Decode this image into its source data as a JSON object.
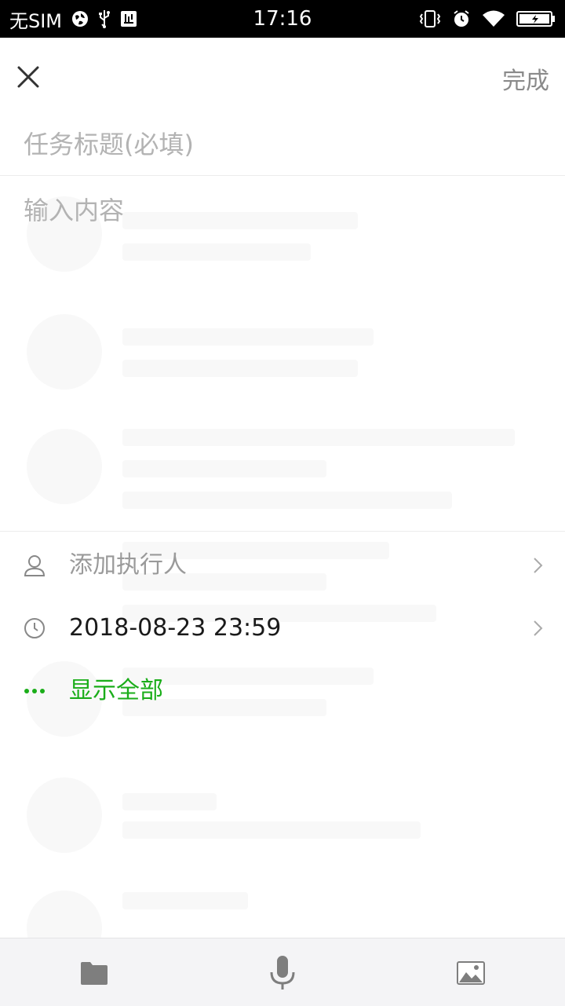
{
  "status_bar": {
    "carrier": "无SIM",
    "time": "17:16"
  },
  "header": {
    "done_label": "完成"
  },
  "form": {
    "title_placeholder": "任务标题(必填)",
    "content_placeholder": "输入内容"
  },
  "options": {
    "assignee_label": "添加执行人",
    "deadline_value": "2018-08-23 23:59",
    "show_all_label": "显示全部"
  },
  "colors": {
    "accent": "#1aad19",
    "placeholder": "#b3b3b3",
    "primary_text": "#1a1a1a",
    "icon_gray": "#888888",
    "toolbar_bg": "#f4f4f6"
  },
  "icons": {
    "close": "close-icon",
    "person": "person-icon",
    "clock": "clock-icon",
    "chevron": "chevron-right-icon",
    "more": "more-dots-icon",
    "folder": "folder-icon",
    "microphone": "microphone-icon",
    "image": "image-icon"
  }
}
